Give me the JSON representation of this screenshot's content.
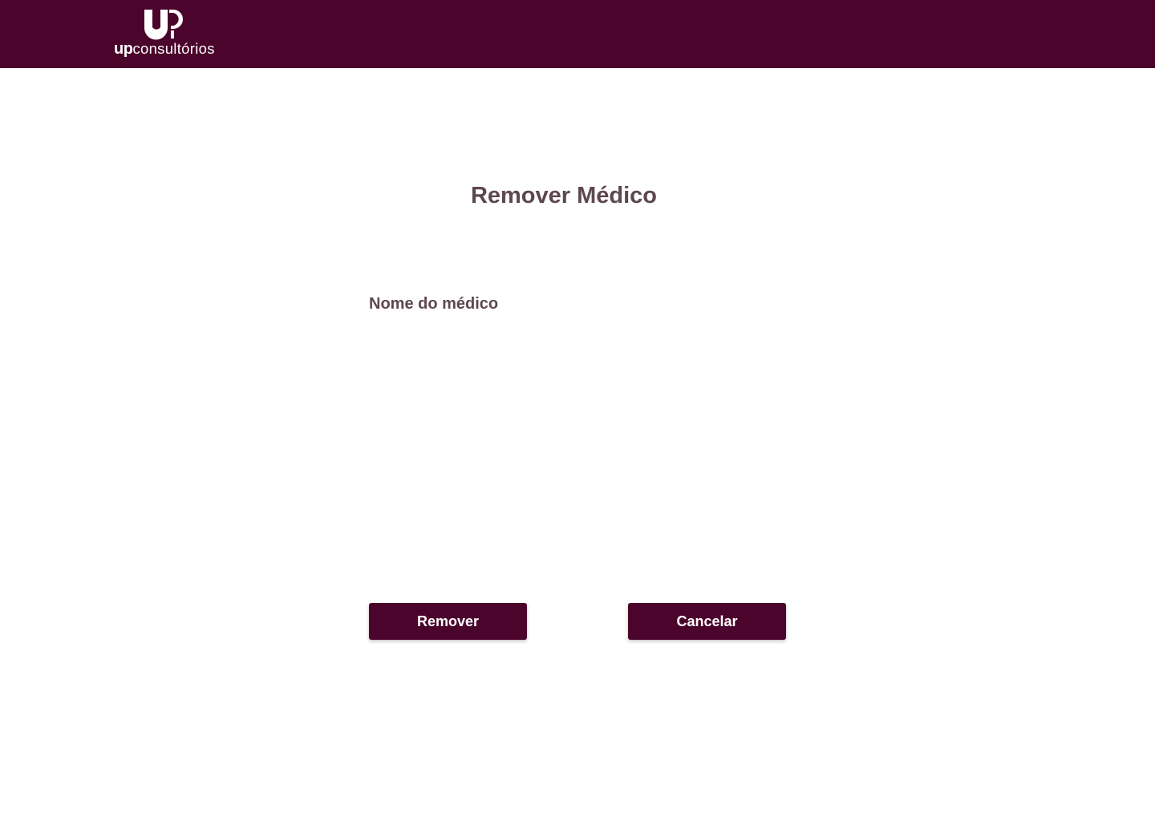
{
  "header": {
    "logo": {
      "icon": "up-logo-mark-icon",
      "word_bold": "up",
      "word_light": "consultórios"
    },
    "background_color": "#4b042b"
  },
  "main": {
    "title": "Remover Médico",
    "field_label": "Nome do médico",
    "buttons": {
      "remove_label": "Remover",
      "cancel_label": "Cancelar"
    }
  },
  "colors": {
    "brand": "#4b042b",
    "text": "#5e4750",
    "background": "#ffffff"
  }
}
